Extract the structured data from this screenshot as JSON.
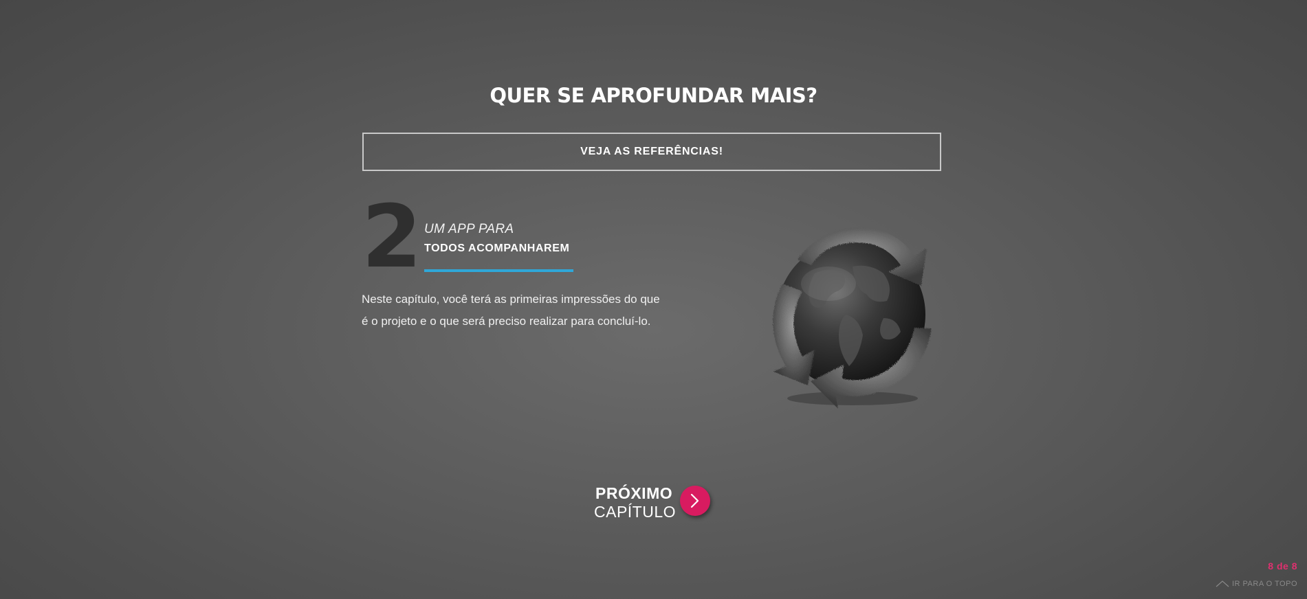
{
  "section": {
    "title": "QUER SE APROFUNDAR MAIS?",
    "references_button": "VEJA AS REFERÊNCIAS!"
  },
  "chapter": {
    "number": "2",
    "title_pre": "UM APP PARA",
    "title_main": "TODOS ACOMPANHAREM",
    "description": "Neste capítulo, você terá as primeiras impressões do que é o projeto e o que será preciso realizar para concluí-lo.",
    "accent_color": "#2fa7d8"
  },
  "next": {
    "line1": "PRÓXIMO",
    "line2": "CAPÍTULO",
    "icon": "chevron-right-icon",
    "button_color": "#d81b60"
  },
  "pager": {
    "text": "8 de 8",
    "color": "#e0306f"
  },
  "back_to_top": {
    "label": "IR PARA O TOPO",
    "icon": "chevron-up-icon"
  },
  "illustration": {
    "icon": "globe-recycle-icon"
  }
}
